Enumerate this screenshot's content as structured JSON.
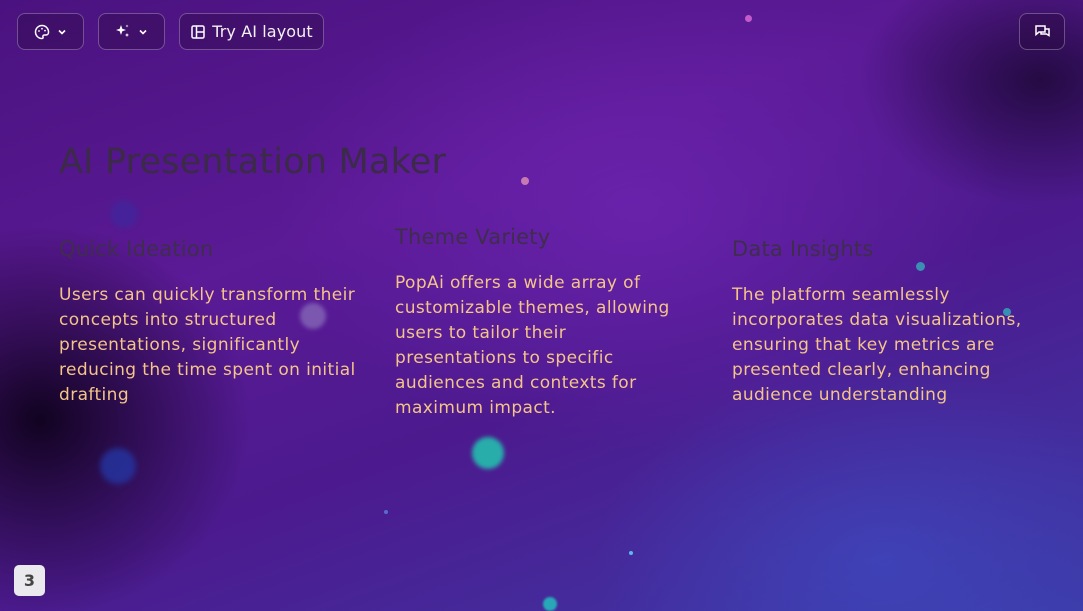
{
  "toolbar": {
    "theme_icon": "palette-icon",
    "ai_icon": "sparkle-icon",
    "chevron_icon": "chevron-down-icon",
    "layout_icon": "layout-icon",
    "layout_label": "Try AI layout",
    "comment_icon": "chat-icon"
  },
  "slide": {
    "title": "AI Presentation Maker",
    "columns": [
      {
        "heading": "Quick Ideation",
        "body": "Users can quickly transform their concepts into structured presentations, significantly reducing the time spent on initial drafting"
      },
      {
        "heading": "Theme Variety",
        "body": "PopAi offers a wide array of customizable themes, allowing users to tailor their presentations to specific audiences and contexts for maximum impact."
      },
      {
        "heading": "Data Insights",
        "body": "The platform seamlessly incorporates data visualizations, ensuring that key metrics are presented clearly, enhancing audience understanding"
      }
    ],
    "page_number": "3"
  },
  "colors": {
    "heading": "#3f2d4e",
    "body": "#f4c48a",
    "background": "#4c1a8e"
  }
}
